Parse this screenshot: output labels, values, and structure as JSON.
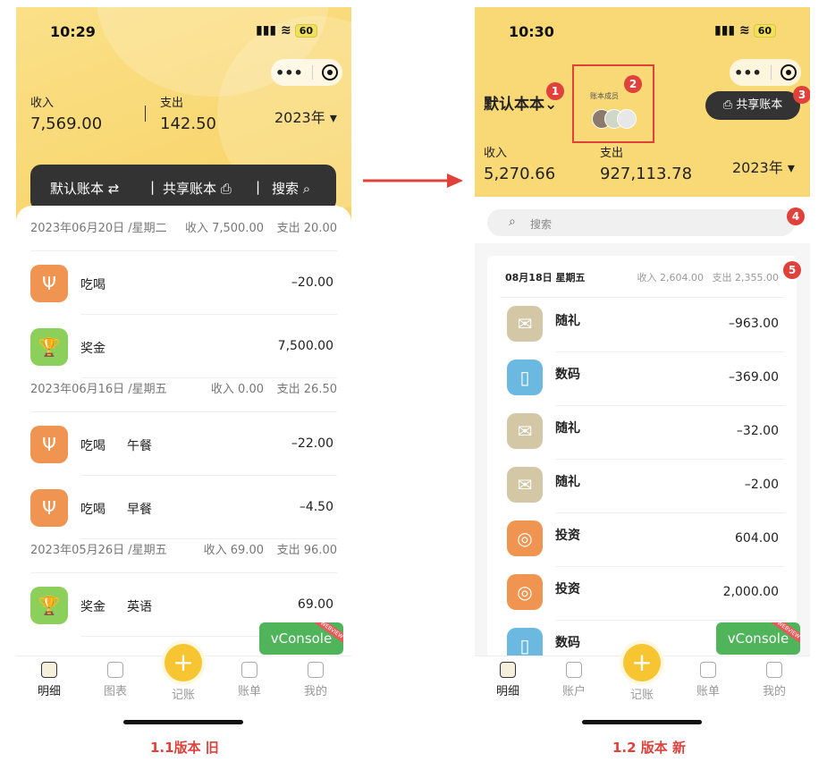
{
  "captions": {
    "left": "1.1版本 旧",
    "right": "1.2 版本 新"
  },
  "old": {
    "time": "10:29",
    "signal": "\u0000",
    "battery": "60",
    "income_label": "收入",
    "income": "7,569.00",
    "expense_label": "支出",
    "expense": "142.50",
    "year": "2023年",
    "bar": {
      "default_book": "默认账本",
      "share_book": "共享账本",
      "search": "搜索"
    },
    "groups": [
      {
        "date": "2023年06月20日 /星期二",
        "income": "收入 7,500.00",
        "expense": "支出 20.00",
        "rows": [
          {
            "icon": "food-icon",
            "color": "#ef9551",
            "name": "吃喝",
            "note": "",
            "amount": "–20.00"
          },
          {
            "icon": "trophy-icon",
            "color": "#8ccf5a",
            "name": "奖金",
            "note": "",
            "amount": "7,500.00"
          }
        ]
      },
      {
        "date": "2023年06月16日 /星期五",
        "income": "收入 0.00",
        "expense": "支出 26.50",
        "rows": [
          {
            "icon": "food-icon",
            "color": "#ef9551",
            "name": "吃喝",
            "note": "午餐",
            "amount": "–22.00"
          },
          {
            "icon": "food-icon",
            "color": "#ef9551",
            "name": "吃喝",
            "note": "早餐",
            "amount": "–4.50"
          }
        ]
      },
      {
        "date": "2023年05月26日 /星期五",
        "income": "收入 69.00",
        "expense": "支出 96.00",
        "rows": [
          {
            "icon": "trophy-icon",
            "color": "#8ccf5a",
            "name": "奖金",
            "note": "英语",
            "amount": "69.00"
          }
        ]
      }
    ],
    "vconsole": "vConsole",
    "vconsole_tag": "WEBVIEW",
    "nav": [
      "明细",
      "图表",
      "记账",
      "账单",
      "我的"
    ]
  },
  "new": {
    "time": "10:30",
    "battery": "60",
    "book_name": "默认本本",
    "members_label": "账本成员",
    "share_button": "共享账本",
    "income_label": "收入",
    "income": "5,270.66",
    "expense_label": "支出",
    "expense": "927,113.78",
    "year": "2023年",
    "search_placeholder": "搜索",
    "group": {
      "date": "08月18日  星期五",
      "income": "收入 2,604.00",
      "expense": "支出 2,355.00"
    },
    "rows": [
      {
        "icon": "gift-icon",
        "color": "#d3c7a6",
        "name": "随礼",
        "amount": "–963.00"
      },
      {
        "icon": "tablet-icon",
        "color": "#6bb8e0",
        "name": "数码",
        "amount": "–369.00"
      },
      {
        "icon": "gift-icon",
        "color": "#d3c7a6",
        "name": "随礼",
        "amount": "–32.00"
      },
      {
        "icon": "gift-icon",
        "color": "#d3c7a6",
        "name": "随礼",
        "amount": "–2.00"
      },
      {
        "icon": "piggy-icon",
        "color": "#ef9551",
        "name": "投资",
        "amount": "604.00"
      },
      {
        "icon": "piggy-icon",
        "color": "#ef9551",
        "name": "投资",
        "amount": "2,000.00"
      },
      {
        "icon": "tablet-icon",
        "color": "#6bb8e0",
        "name": "数码",
        "amount": ""
      }
    ],
    "vconsole": "vConsole",
    "vconsole_tag": "WEBVIEW",
    "nav": [
      "明细",
      "账户",
      "记账",
      "账单",
      "我的"
    ],
    "badges": [
      "1",
      "2",
      "3",
      "4",
      "5"
    ]
  }
}
